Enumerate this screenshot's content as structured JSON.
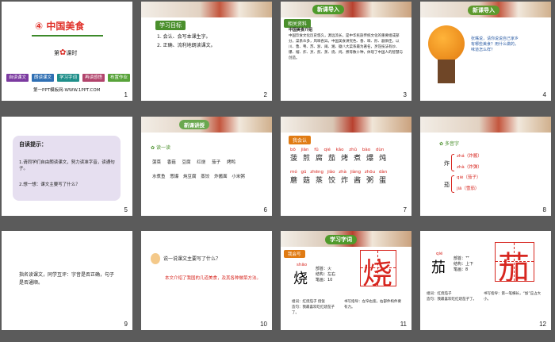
{
  "slides": [
    {
      "num": "1",
      "title": "④ 中国美食",
      "keshi_pre": "第",
      "keshi_post": "课时",
      "pills": [
        "自读课文",
        "朗读课文",
        "学习字词",
        "再读感悟",
        "布置作业"
      ],
      "footer": "第一PPT模板网-WWW.1PPT.COM"
    },
    {
      "num": "2",
      "tag": "学习目标",
      "lines": [
        "1. 会认、会写本课生字。",
        "2. 正确、流利地朗读课文。"
      ]
    },
    {
      "num": "3",
      "banner": "新课导入",
      "sub": "相关资料",
      "heading": "中国美食介绍",
      "body": "中国饮食文化历史悠久，源远流长，是中华民族传统文化的重要组成部分，菜系众多，风味各异。中国美食讲究色、香、味、形、器俱佳，以川、鲁、粤、苏、浙、闽、湘、徽八大菜系最为著名，烹饪技法有炒、爆、熘、炸、烹、煎、蒸、烧、炖、煮等数十种，体现了中国人的智慧与创造。"
    },
    {
      "num": "4",
      "banner": "新课导入",
      "text": "张嘴说，请你说说自己家乡有哪些美食？用什么做的，味道怎么样？"
    },
    {
      "num": "5",
      "title": "自读提示：",
      "items": [
        "1.请同学们自由朗读课文，努力读准字音，读通句子。",
        "2.想一想：课文主要写了什么？"
      ]
    },
    {
      "num": "6",
      "banner": "新课讲授",
      "sub": "读一读",
      "words": [
        [
          "菠菜",
          "香菇",
          "豆腐",
          "红烧",
          "茄子",
          "烤鸭"
        ],
        [
          "水煮鱼",
          "葱爆",
          "炖豆腐",
          "蒸饺",
          "炸酱面",
          "小米粥"
        ]
      ]
    },
    {
      "num": "7",
      "sub": "我会认",
      "pinyin1": [
        "bō",
        "jiān",
        "fǔ",
        "qié",
        "kǎo",
        "zhǔ",
        "bào",
        "dùn"
      ],
      "chars1": [
        "菠",
        "煎",
        "腐",
        "茄",
        "烤",
        "煮",
        "爆",
        "炖"
      ],
      "pinyin2": [
        "mó",
        "gū",
        "zhēng",
        "jiǎo",
        "zhà",
        "jiàng",
        "zhōu",
        "dàn"
      ],
      "chars2": [
        "蘑",
        "菇",
        "蒸",
        "饺",
        "炸",
        "酱",
        "粥",
        "蛋"
      ]
    },
    {
      "num": "8",
      "sub": "多音字",
      "groups": [
        {
          "char": "炸",
          "readings": [
            "zhá（炸酱）",
            "zhà（炸弹）"
          ]
        },
        {
          "char": "茄",
          "readings": [
            "qié（茄子）",
            "jiā（雪茄）"
          ]
        }
      ]
    },
    {
      "num": "9",
      "text": "指名读课文，同学互评：字音是否正确，句子是否通顺。"
    },
    {
      "num": "10",
      "question": "说一说课文主要写了什么？",
      "answer": "本文介绍了我国的几道美食，及其各种做菜方法。"
    },
    {
      "num": "11",
      "banner": "学习字词",
      "sub": "我会写",
      "pinyin": "shāo",
      "char": "烧",
      "info": [
        "部首：火",
        "结构：左右",
        "笔画：10"
      ],
      "bottom": [
        "组词：红烧茄子  烧饭",
        "造句：我最喜欢吃红烧茄子了。",
        "书写指导：左窄右宽，右部件构件要有力。"
      ]
    },
    {
      "num": "12",
      "pinyin": "qié",
      "char": "茄",
      "info": [
        "部首：艹",
        "结构：上下",
        "笔画：8"
      ],
      "bottom": [
        "组词：红烧茄子",
        "造句：我最喜欢吃红烧茄子了。",
        "书写指导：第一笔横长，“加”应占大小。"
      ]
    }
  ],
  "colors": {
    "red": "#d7261f",
    "green": "#4a8f2c",
    "orange": "#e07b13",
    "bg": "#5b5b5b"
  }
}
